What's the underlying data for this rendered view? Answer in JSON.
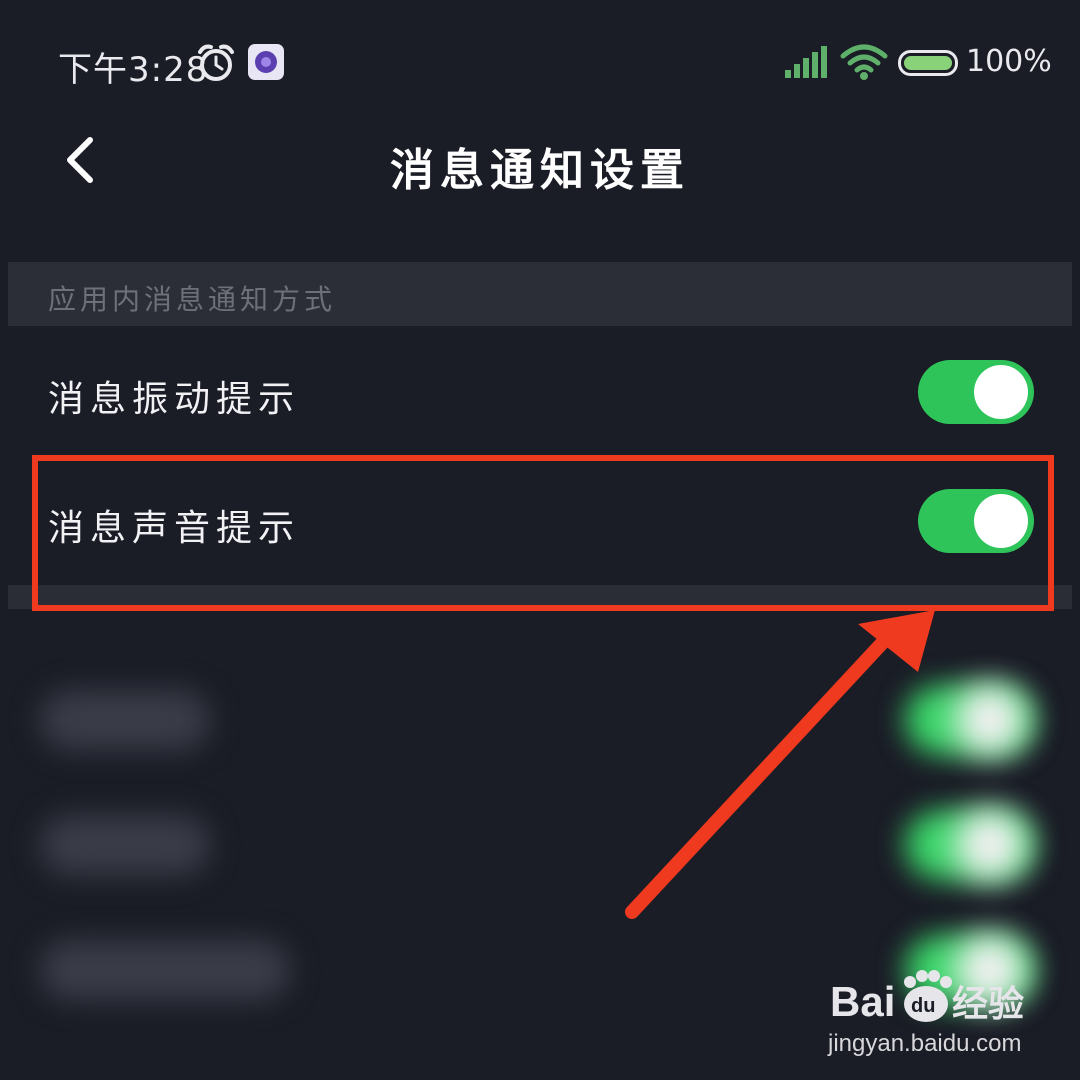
{
  "status_bar": {
    "time": "下午3:28",
    "battery": "100%",
    "icons": [
      "alarm-icon",
      "app-icon",
      "signal-icon",
      "wifi-icon",
      "battery-icon"
    ]
  },
  "header": {
    "title": "消息通知设置",
    "back_icon": "chevron-left-icon"
  },
  "section": {
    "label": "应用内消息通知方式"
  },
  "settings": [
    {
      "label": "消息振动提示",
      "enabled": true
    },
    {
      "label": "消息声音提示",
      "enabled": true
    }
  ],
  "colors": {
    "background": "#1a1c26",
    "section_bg": "#2b2d37",
    "toggle_on": "#2fc45a",
    "highlight": "#f03a1f"
  },
  "watermark": {
    "logo_text": "Baidu经验",
    "url": "jingyan.baidu.com"
  }
}
